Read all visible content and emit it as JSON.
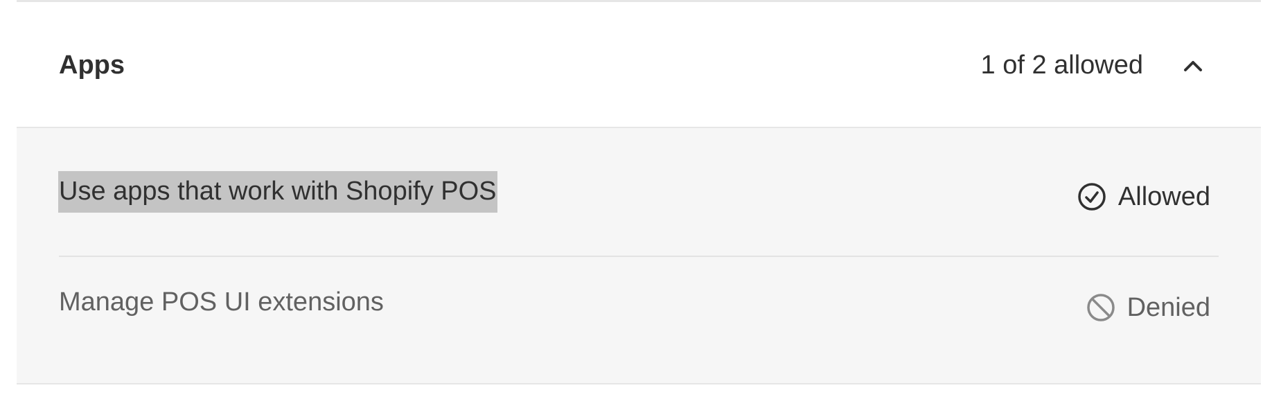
{
  "section": {
    "title": "Apps",
    "count_label": "1 of 2 allowed",
    "expanded": true
  },
  "permissions": [
    {
      "label": "Use apps that work with Shopify POS",
      "status": "Allowed",
      "status_icon": "check-circle-icon",
      "selected": true
    },
    {
      "label": "Manage POS UI extensions",
      "status": "Denied",
      "status_icon": "prohibited-icon",
      "selected": false
    }
  ],
  "colors": {
    "text_primary": "#303030",
    "text_secondary": "#616161",
    "body_background": "#f6f6f6",
    "divider": "#e6e6e6",
    "selection_highlight": "#c4c4c4"
  }
}
